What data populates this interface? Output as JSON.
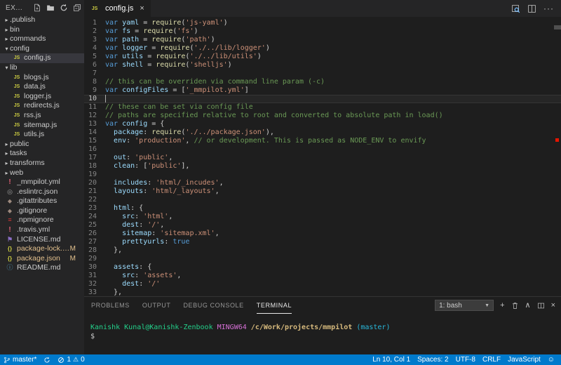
{
  "explorer": {
    "title": "EX...",
    "actions": [
      {
        "name": "new-file-icon"
      },
      {
        "name": "new-folder-icon"
      },
      {
        "name": "refresh-icon"
      },
      {
        "name": "collapse-all-icon"
      }
    ],
    "items": [
      {
        "kind": "folder",
        "label": ".publish",
        "depth": 0,
        "expanded": false
      },
      {
        "kind": "folder",
        "label": "bin",
        "depth": 0,
        "expanded": false
      },
      {
        "kind": "folder",
        "label": "commands",
        "depth": 0,
        "expanded": false
      },
      {
        "kind": "folder",
        "label": "config",
        "depth": 0,
        "expanded": true
      },
      {
        "kind": "file",
        "icon": "js",
        "label": "config.js",
        "depth": 1,
        "selected": true
      },
      {
        "kind": "folder",
        "label": "lib",
        "depth": 0,
        "expanded": true
      },
      {
        "kind": "file",
        "icon": "js",
        "label": "blogs.js",
        "depth": 1
      },
      {
        "kind": "file",
        "icon": "js",
        "label": "data.js",
        "depth": 1
      },
      {
        "kind": "file",
        "icon": "js",
        "label": "logger.js",
        "depth": 1
      },
      {
        "kind": "file",
        "icon": "js",
        "label": "redirects.js",
        "depth": 1
      },
      {
        "kind": "file",
        "icon": "js",
        "label": "rss.js",
        "depth": 1
      },
      {
        "kind": "file",
        "icon": "js",
        "label": "sitemap.js",
        "depth": 1
      },
      {
        "kind": "file",
        "icon": "js",
        "label": "utils.js",
        "depth": 1
      },
      {
        "kind": "folder",
        "label": "public",
        "depth": 0,
        "expanded": false
      },
      {
        "kind": "folder",
        "label": "tasks",
        "depth": 0,
        "expanded": false
      },
      {
        "kind": "folder",
        "label": "transforms",
        "depth": 0,
        "expanded": false
      },
      {
        "kind": "folder",
        "label": "web",
        "depth": 0,
        "expanded": false
      },
      {
        "kind": "file",
        "icon": "yml",
        "label": "_mmpilot.yml",
        "depth": 0
      },
      {
        "kind": "file",
        "icon": "eslint",
        "label": ".eslintrc.json",
        "depth": 0
      },
      {
        "kind": "file",
        "icon": "git",
        "label": ".gitattributes",
        "depth": 0
      },
      {
        "kind": "file",
        "icon": "git",
        "label": ".gitignore",
        "depth": 0
      },
      {
        "kind": "file",
        "icon": "npm",
        "label": ".npmignore",
        "depth": 0
      },
      {
        "kind": "file",
        "icon": "yml",
        "label": ".travis.yml",
        "depth": 0
      },
      {
        "kind": "file",
        "icon": "license",
        "label": "LICENSE.md",
        "depth": 0
      },
      {
        "kind": "file",
        "icon": "json",
        "label": "package-lock.json",
        "depth": 0,
        "badge": "M",
        "modified": true
      },
      {
        "kind": "file",
        "icon": "json",
        "label": "package.json",
        "depth": 0,
        "badge": "M",
        "modified": true
      },
      {
        "kind": "file",
        "icon": "readme",
        "label": "README.md",
        "depth": 0
      }
    ]
  },
  "editor": {
    "tab": {
      "icon": "JS",
      "label": "config.js",
      "close": "×"
    },
    "actions_ellipsis": "···",
    "cursor_line": 10,
    "code_lines": [
      {
        "n": "1",
        "tokens": [
          [
            "k",
            "var"
          ],
          [
            "o",
            " "
          ],
          [
            "v",
            "yaml"
          ],
          [
            "o",
            " = "
          ],
          [
            "f",
            "require"
          ],
          [
            "p",
            "("
          ],
          [
            "s",
            "'js-yaml'"
          ],
          [
            "p",
            ")"
          ]
        ]
      },
      {
        "n": "2",
        "tokens": [
          [
            "k",
            "var"
          ],
          [
            "o",
            " "
          ],
          [
            "v",
            "fs"
          ],
          [
            "o",
            " = "
          ],
          [
            "f",
            "require"
          ],
          [
            "p",
            "("
          ],
          [
            "s",
            "'fs'"
          ],
          [
            "p",
            ")"
          ]
        ]
      },
      {
        "n": "3",
        "tokens": [
          [
            "k",
            "var"
          ],
          [
            "o",
            " "
          ],
          [
            "v",
            "path"
          ],
          [
            "o",
            " = "
          ],
          [
            "f",
            "require"
          ],
          [
            "p",
            "("
          ],
          [
            "s",
            "'path'"
          ],
          [
            "p",
            ")"
          ]
        ]
      },
      {
        "n": "4",
        "tokens": [
          [
            "k",
            "var"
          ],
          [
            "o",
            " "
          ],
          [
            "v",
            "logger"
          ],
          [
            "o",
            " = "
          ],
          [
            "f",
            "require"
          ],
          [
            "p",
            "("
          ],
          [
            "s",
            "'./../lib/logger'"
          ],
          [
            "p",
            ")"
          ]
        ]
      },
      {
        "n": "5",
        "tokens": [
          [
            "k",
            "var"
          ],
          [
            "o",
            " "
          ],
          [
            "v",
            "utils"
          ],
          [
            "o",
            " = "
          ],
          [
            "f",
            "require"
          ],
          [
            "p",
            "("
          ],
          [
            "s",
            "'./../lib/utils'"
          ],
          [
            "p",
            ")"
          ]
        ]
      },
      {
        "n": "6",
        "tokens": [
          [
            "k",
            "var"
          ],
          [
            "o",
            " "
          ],
          [
            "v",
            "shell"
          ],
          [
            "o",
            " = "
          ],
          [
            "f",
            "require"
          ],
          [
            "p",
            "("
          ],
          [
            "s",
            "'shelljs'"
          ],
          [
            "p",
            ")"
          ]
        ]
      },
      {
        "n": "7",
        "tokens": []
      },
      {
        "n": "8",
        "tokens": [
          [
            "c",
            "// this can be overriden via command line param (-c)"
          ]
        ]
      },
      {
        "n": "9",
        "tokens": [
          [
            "k",
            "var"
          ],
          [
            "o",
            " "
          ],
          [
            "v",
            "configFiles"
          ],
          [
            "o",
            " = "
          ],
          [
            "p",
            "["
          ],
          [
            "s",
            "'_mmpilot.yml'"
          ],
          [
            "p",
            "]"
          ]
        ]
      },
      {
        "n": "10",
        "tokens": []
      },
      {
        "n": "11",
        "tokens": [
          [
            "c",
            "// these can be set via config file"
          ]
        ]
      },
      {
        "n": "12",
        "tokens": [
          [
            "c",
            "// paths are specified relative to root and converted to absolute path in load()"
          ]
        ]
      },
      {
        "n": "13",
        "tokens": [
          [
            "k",
            "var"
          ],
          [
            "o",
            " "
          ],
          [
            "v",
            "config"
          ],
          [
            "o",
            " = "
          ],
          [
            "p",
            "{"
          ]
        ]
      },
      {
        "n": "14",
        "tokens": [
          [
            "o",
            "  "
          ],
          [
            "v",
            "package"
          ],
          [
            "o",
            ": "
          ],
          [
            "f",
            "require"
          ],
          [
            "p",
            "("
          ],
          [
            "s",
            "'./../package.json'"
          ],
          [
            "p",
            "),"
          ]
        ]
      },
      {
        "n": "15",
        "tokens": [
          [
            "o",
            "  "
          ],
          [
            "v",
            "env"
          ],
          [
            "o",
            ": "
          ],
          [
            "s",
            "'production'"
          ],
          [
            "o",
            ", "
          ],
          [
            "c",
            "// or development. This is passed as NODE_ENV to envify"
          ]
        ]
      },
      {
        "n": "16",
        "tokens": []
      },
      {
        "n": "17",
        "tokens": [
          [
            "o",
            "  "
          ],
          [
            "v",
            "out"
          ],
          [
            "o",
            ": "
          ],
          [
            "s",
            "'public'"
          ],
          [
            "o",
            ","
          ]
        ]
      },
      {
        "n": "18",
        "tokens": [
          [
            "o",
            "  "
          ],
          [
            "v",
            "clean"
          ],
          [
            "o",
            ": ["
          ],
          [
            "s",
            "'public'"
          ],
          [
            "o",
            "],"
          ]
        ]
      },
      {
        "n": "19",
        "tokens": []
      },
      {
        "n": "20",
        "tokens": [
          [
            "o",
            "  "
          ],
          [
            "v",
            "includes"
          ],
          [
            "o",
            ": "
          ],
          [
            "s",
            "'html/_incudes'"
          ],
          [
            "o",
            ","
          ]
        ]
      },
      {
        "n": "21",
        "tokens": [
          [
            "o",
            "  "
          ],
          [
            "v",
            "layouts"
          ],
          [
            "o",
            ": "
          ],
          [
            "s",
            "'html/_layouts'"
          ],
          [
            "o",
            ","
          ]
        ]
      },
      {
        "n": "22",
        "tokens": []
      },
      {
        "n": "23",
        "tokens": [
          [
            "o",
            "  "
          ],
          [
            "v",
            "html"
          ],
          [
            "o",
            ": {"
          ]
        ]
      },
      {
        "n": "24",
        "tokens": [
          [
            "o",
            "    "
          ],
          [
            "v",
            "src"
          ],
          [
            "o",
            ": "
          ],
          [
            "s",
            "'html'"
          ],
          [
            "o",
            ","
          ]
        ]
      },
      {
        "n": "25",
        "tokens": [
          [
            "o",
            "    "
          ],
          [
            "v",
            "dest"
          ],
          [
            "o",
            ": "
          ],
          [
            "s",
            "'/'"
          ],
          [
            "o",
            ","
          ]
        ]
      },
      {
        "n": "26",
        "tokens": [
          [
            "o",
            "    "
          ],
          [
            "v",
            "sitemap"
          ],
          [
            "o",
            ": "
          ],
          [
            "s",
            "'sitemap.xml'"
          ],
          [
            "o",
            ","
          ]
        ]
      },
      {
        "n": "27",
        "tokens": [
          [
            "o",
            "    "
          ],
          [
            "v",
            "prettyurls"
          ],
          [
            "o",
            ": "
          ],
          [
            "b",
            "true"
          ]
        ]
      },
      {
        "n": "28",
        "tokens": [
          [
            "o",
            "  },"
          ]
        ]
      },
      {
        "n": "29",
        "tokens": []
      },
      {
        "n": "30",
        "tokens": [
          [
            "o",
            "  "
          ],
          [
            "v",
            "assets"
          ],
          [
            "o",
            ": {"
          ]
        ]
      },
      {
        "n": "31",
        "tokens": [
          [
            "o",
            "    "
          ],
          [
            "v",
            "src"
          ],
          [
            "o",
            ": "
          ],
          [
            "s",
            "'assets'"
          ],
          [
            "o",
            ","
          ]
        ]
      },
      {
        "n": "32",
        "tokens": [
          [
            "o",
            "    "
          ],
          [
            "v",
            "dest"
          ],
          [
            "o",
            ": "
          ],
          [
            "s",
            "'/'"
          ]
        ]
      },
      {
        "n": "33",
        "tokens": [
          [
            "o",
            "  },"
          ]
        ]
      }
    ]
  },
  "panel": {
    "tabs": [
      {
        "label": "PROBLEMS",
        "active": false
      },
      {
        "label": "OUTPUT",
        "active": false
      },
      {
        "label": "DEBUG CONSOLE",
        "active": false
      },
      {
        "label": "TERMINAL",
        "active": true
      }
    ],
    "shell_select": "1: bash",
    "icons": {
      "add": "+",
      "chevron_up": "∧",
      "close": "×"
    },
    "terminal_lines": [
      [
        [
          "tg",
          "Kanishk Kunal@Kanishk-Zenbook "
        ],
        [
          "tm",
          "MINGW64 "
        ],
        [
          "ty",
          "/c/Work/projects/mmpilot "
        ],
        [
          "tc",
          "(master)"
        ]
      ],
      [
        [
          "tw",
          "$"
        ]
      ]
    ]
  },
  "status_bar": {
    "branch": "master*",
    "errors": "1",
    "warnings": "0",
    "warning_glyph": "⚠",
    "line_col": "Ln 10, Col 1",
    "spaces": "Spaces: 2",
    "encoding": "UTF-8",
    "eol": "CRLF",
    "language": "JavaScript",
    "smiley": "☺"
  },
  "colors": {
    "accent": "#007acc",
    "sidebar_bg": "#252526",
    "editor_bg": "#1e1e1e",
    "selection_row": "#37373d",
    "git_modified": "#e2c08d",
    "error_marker": "#e51400",
    "terminal_green": "#23d18b",
    "terminal_magenta": "#d670d6",
    "terminal_yellow": "#d7ba7d",
    "terminal_cyan": "#29b8db"
  }
}
